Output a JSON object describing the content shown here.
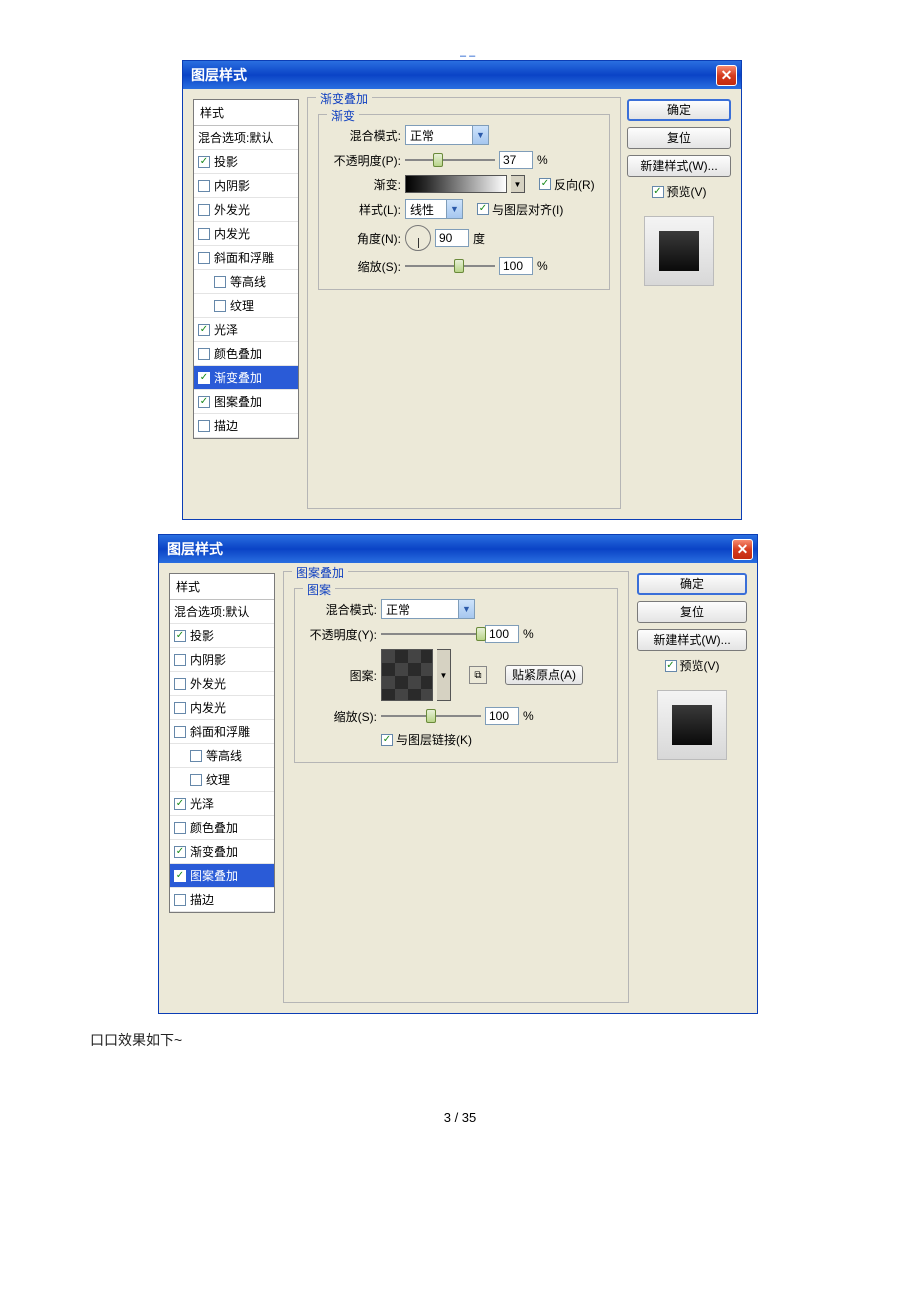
{
  "top_mark": "– –",
  "dialog1": {
    "title": "图层样式",
    "styles_header": "样式",
    "blend_header": "混合选项:默认",
    "items": [
      {
        "label": "投影",
        "checked": true
      },
      {
        "label": "内阴影",
        "checked": false
      },
      {
        "label": "外发光",
        "checked": false
      },
      {
        "label": "内发光",
        "checked": false
      },
      {
        "label": "斜面和浮雕",
        "checked": false
      },
      {
        "label": "等高线",
        "checked": false,
        "indent": true
      },
      {
        "label": "纹理",
        "checked": false,
        "indent": true
      },
      {
        "label": "光泽",
        "checked": true
      },
      {
        "label": "颜色叠加",
        "checked": false
      },
      {
        "label": "渐变叠加",
        "checked": true,
        "selected": true
      },
      {
        "label": "图案叠加",
        "checked": true
      },
      {
        "label": "描边",
        "checked": false
      }
    ],
    "panel_title": "渐变叠加",
    "inner_title": "渐变",
    "blend_mode_label": "混合模式:",
    "blend_mode_value": "正常",
    "opacity_label": "不透明度(P):",
    "opacity_value": "37",
    "opacity_unit": "%",
    "gradient_label": "渐变:",
    "reverse_label": "反向(R)",
    "style_label": "样式(L):",
    "style_value": "线性",
    "align_label": "与图层对齐(I)",
    "angle_label": "角度(N):",
    "angle_value": "90",
    "angle_unit": "度",
    "scale_label": "缩放(S):",
    "scale_value": "100",
    "scale_unit": "%",
    "buttons": {
      "ok": "确定",
      "reset": "复位",
      "new_style": "新建样式(W)...",
      "preview": "预览(V)"
    }
  },
  "dialog2": {
    "title": "图层样式",
    "styles_header": "样式",
    "blend_header": "混合选项:默认",
    "items": [
      {
        "label": "投影",
        "checked": true
      },
      {
        "label": "内阴影",
        "checked": false
      },
      {
        "label": "外发光",
        "checked": false
      },
      {
        "label": "内发光",
        "checked": false
      },
      {
        "label": "斜面和浮雕",
        "checked": false
      },
      {
        "label": "等高线",
        "checked": false,
        "indent": true
      },
      {
        "label": "纹理",
        "checked": false,
        "indent": true
      },
      {
        "label": "光泽",
        "checked": true
      },
      {
        "label": "颜色叠加",
        "checked": false
      },
      {
        "label": "渐变叠加",
        "checked": true
      },
      {
        "label": "图案叠加",
        "checked": true,
        "selected": true
      },
      {
        "label": "描边",
        "checked": false
      }
    ],
    "panel_title": "图案叠加",
    "inner_title": "图案",
    "blend_mode_label": "混合模式:",
    "blend_mode_value": "正常",
    "opacity_label": "不透明度(Y):",
    "opacity_value": "100",
    "opacity_unit": "%",
    "pattern_label": "图案:",
    "snap_origin": "贴紧原点(A)",
    "scale_label": "缩放(S):",
    "scale_value": "100",
    "scale_unit": "%",
    "link_label": "与图层链接(K)",
    "buttons": {
      "ok": "确定",
      "reset": "复位",
      "new_style": "新建样式(W)...",
      "preview": "预览(V)"
    }
  },
  "caption": "口口效果如下~",
  "page_number": "3 / 35"
}
